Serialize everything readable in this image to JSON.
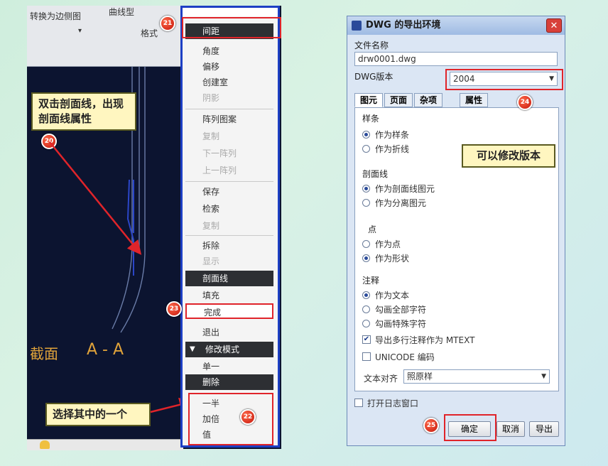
{
  "cad": {
    "toolbar": {
      "item1": "转换为边侧图",
      "item2": "曲线型",
      "item3": "格式",
      "arrow": "▾"
    },
    "section_label": "截面",
    "section_name": "A - A"
  },
  "callouts": {
    "double_click": "双击剖面线，出现剖面线属性",
    "choose_one": "选择其中的一个",
    "change_version": "可以修改版本"
  },
  "badges": {
    "b20": "20",
    "b21": "21",
    "b22": "22",
    "b23": "23",
    "b24": "24",
    "b25": "25"
  },
  "menu": {
    "top_item": "间距",
    "items": [
      "角度",
      "偏移",
      "创建室",
      "阴影",
      "阵列图案",
      "复制",
      "下一阵列",
      "上一阵列",
      "保存",
      "检索",
      "复制",
      "拆除",
      "显示"
    ],
    "section_header": "剖面线",
    "fill": "填充",
    "done": "完成",
    "quit": "退出",
    "mode_header": "修改模式",
    "single": "单一",
    "mode_dark": "删除",
    "options": [
      "一半",
      "加倍",
      "值"
    ]
  },
  "dialog": {
    "title": "DWG 的导出环境",
    "close": "✕",
    "filename_label": "文件名称",
    "filename_value": "drw0001.dwg",
    "version_label": "DWG版本",
    "version_value": "2004",
    "tabs": [
      "图元",
      "页面",
      "杂项",
      "属性"
    ],
    "group_line": "样条",
    "line_opt1": "作为样条",
    "line_opt2": "作为折线",
    "group_section": "剖面线",
    "section_opt1": "作为剖面线图元",
    "section_opt2": "作为分离图元",
    "group_point": "点",
    "point_opt1": "作为点",
    "point_opt2": "作为形状",
    "group_note": "注释",
    "note_opt1": "作为文本",
    "note_opt2": "勾画全部字符",
    "note_opt3": "勾画特殊字符",
    "check_mtext": "导出多行注释作为 MTEXT",
    "check_unicode": "UNICODE 编码",
    "align_label": "文本对齐",
    "align_value": "照原样",
    "log_label": "打开日志窗口",
    "ok": "确定",
    "cancel": "取消",
    "export": "导出"
  }
}
